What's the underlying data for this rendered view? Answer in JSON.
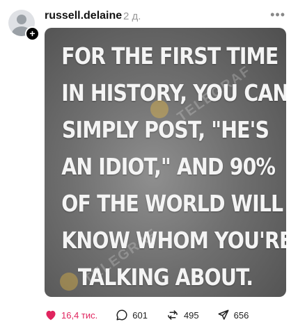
{
  "post": {
    "username": "russell.delaine",
    "time": "2 д.",
    "image_text": [
      "FOR THE FIRST TIME",
      "IN HISTORY, YOU CAN",
      "SIMPLY POST, \"HE'S",
      "AN IDIOT,\" AND 90%",
      "OF THE WORLD WILL",
      "KNOW WHOM YOU'RE",
      "TALKING ABOUT."
    ],
    "watermark": "TELEGRAF"
  },
  "actions": {
    "likes": "16,4 тис.",
    "comments": "601",
    "reposts": "495",
    "shares": "656"
  },
  "colors": {
    "like": "#e0245e",
    "muted": "#999999"
  }
}
